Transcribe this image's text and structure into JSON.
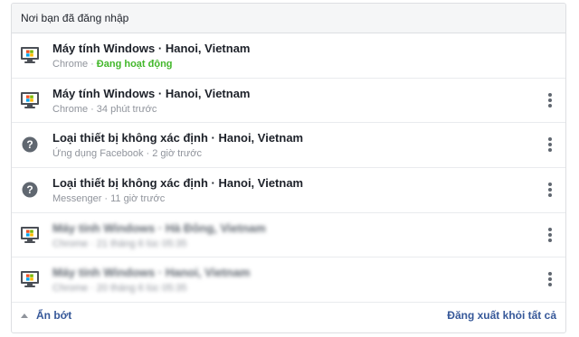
{
  "panel": {
    "title": "Nơi bạn đã đăng nhập"
  },
  "sessions": [
    {
      "icon": "windows-monitor-icon",
      "title": "Máy tính Windows · Hanoi, Vietnam",
      "app": "Chrome",
      "status": "Đang hoạt động",
      "status_active": true,
      "has_menu": false,
      "blurred": false
    },
    {
      "icon": "windows-monitor-icon",
      "title": "Máy tính Windows · Hanoi, Vietnam",
      "app": "Chrome",
      "status": "34 phút trước",
      "status_active": false,
      "has_menu": true,
      "blurred": false
    },
    {
      "icon": "question-icon",
      "title": "Loại thiết bị không xác định · Hanoi, Vietnam",
      "app": "Ứng dụng Facebook",
      "status": "2 giờ trước",
      "status_active": false,
      "has_menu": true,
      "blurred": false
    },
    {
      "icon": "question-icon",
      "title": "Loại thiết bị không xác định · Hanoi, Vietnam",
      "app": "Messenger",
      "status": "11 giờ trước",
      "status_active": false,
      "has_menu": true,
      "blurred": false
    },
    {
      "icon": "windows-monitor-icon",
      "title": "Máy tính Windows · Hà Đông, Vietnam",
      "app": "Chrome",
      "status": "21 tháng 6 lúc 05:35",
      "status_active": false,
      "has_menu": true,
      "blurred": true
    },
    {
      "icon": "windows-monitor-icon",
      "title": "Máy tính Windows · Hanoi, Vietnam",
      "app": "Chrome",
      "status": "20 tháng 6 lúc 05:35",
      "status_active": false,
      "has_menu": true,
      "blurred": true
    }
  ],
  "footer": {
    "collapse_label": "Ẩn bớt",
    "logout_all_label": "Đăng xuất khỏi tất cả"
  },
  "colors": {
    "active_status": "#42b72a",
    "link": "#365899",
    "header_bg": "#f5f6f7"
  }
}
